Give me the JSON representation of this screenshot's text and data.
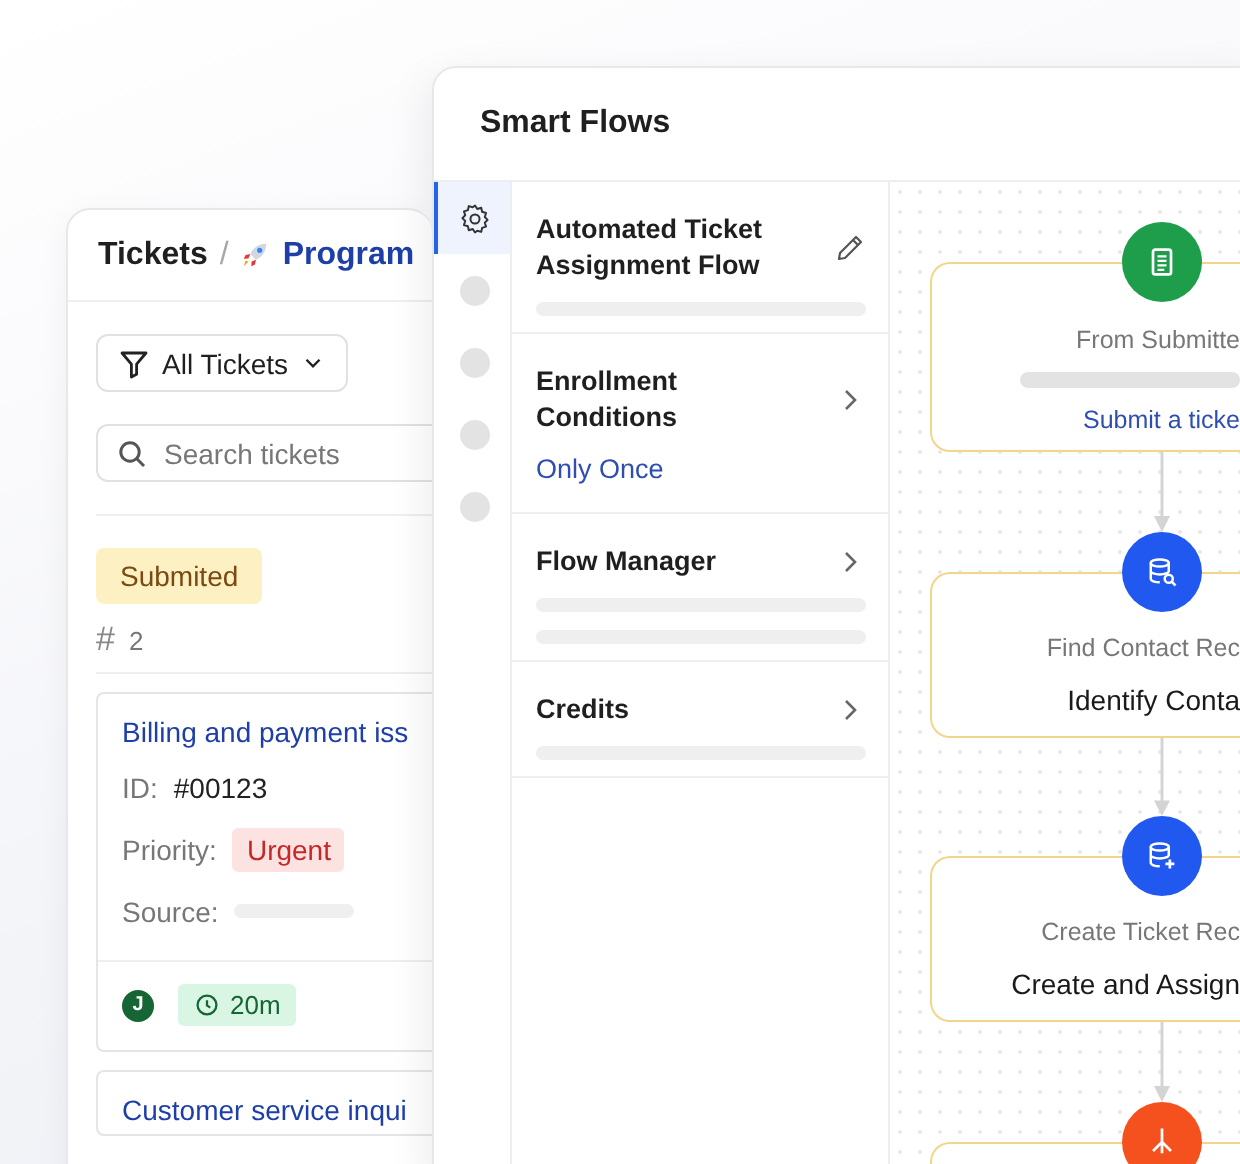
{
  "tickets_panel": {
    "title": "Tickets",
    "separator": "/",
    "program": "Program",
    "filter": {
      "label": "All Tickets"
    },
    "search": {
      "placeholder": "Search tickets"
    },
    "status_badge": "Submited",
    "count_symbol": "#",
    "count": "2",
    "tickets": [
      {
        "title": "Billing and payment iss",
        "id_label": "ID:",
        "id": "#00123",
        "priority_label": "Priority:",
        "priority": "Urgent",
        "source_label": "Source:",
        "assignee_initial": "J",
        "timer": "20m"
      },
      {
        "title": "Customer service inqui"
      }
    ]
  },
  "flows_panel": {
    "title": "Smart Flows",
    "rail": [
      {
        "kind": "settings",
        "selected": true
      },
      {
        "kind": "step",
        "selected": false
      },
      {
        "kind": "step",
        "selected": false
      },
      {
        "kind": "step",
        "selected": false
      },
      {
        "kind": "step",
        "selected": false
      }
    ],
    "sections": [
      {
        "title": "Automated Ticket Assignment Flow",
        "kind": "header"
      },
      {
        "title": "Enrollment Conditions",
        "kind": "value",
        "value": "Only Once"
      },
      {
        "title": "Flow Manager",
        "kind": "list"
      },
      {
        "title": "Credits",
        "kind": "item"
      }
    ],
    "nodes": [
      {
        "kind": "form",
        "color": "#1e9e4a",
        "caption": "From Submitte",
        "link": "Submit a ticke"
      },
      {
        "kind": "find_record",
        "color": "#2158f0",
        "caption": "Find Contact Rec",
        "title": "Identify Conta"
      },
      {
        "kind": "create_record",
        "color": "#2158f0",
        "caption": "Create Ticket Rec",
        "title": "Create and Assign"
      },
      {
        "kind": "branch",
        "color": "#f4511e"
      }
    ]
  }
}
